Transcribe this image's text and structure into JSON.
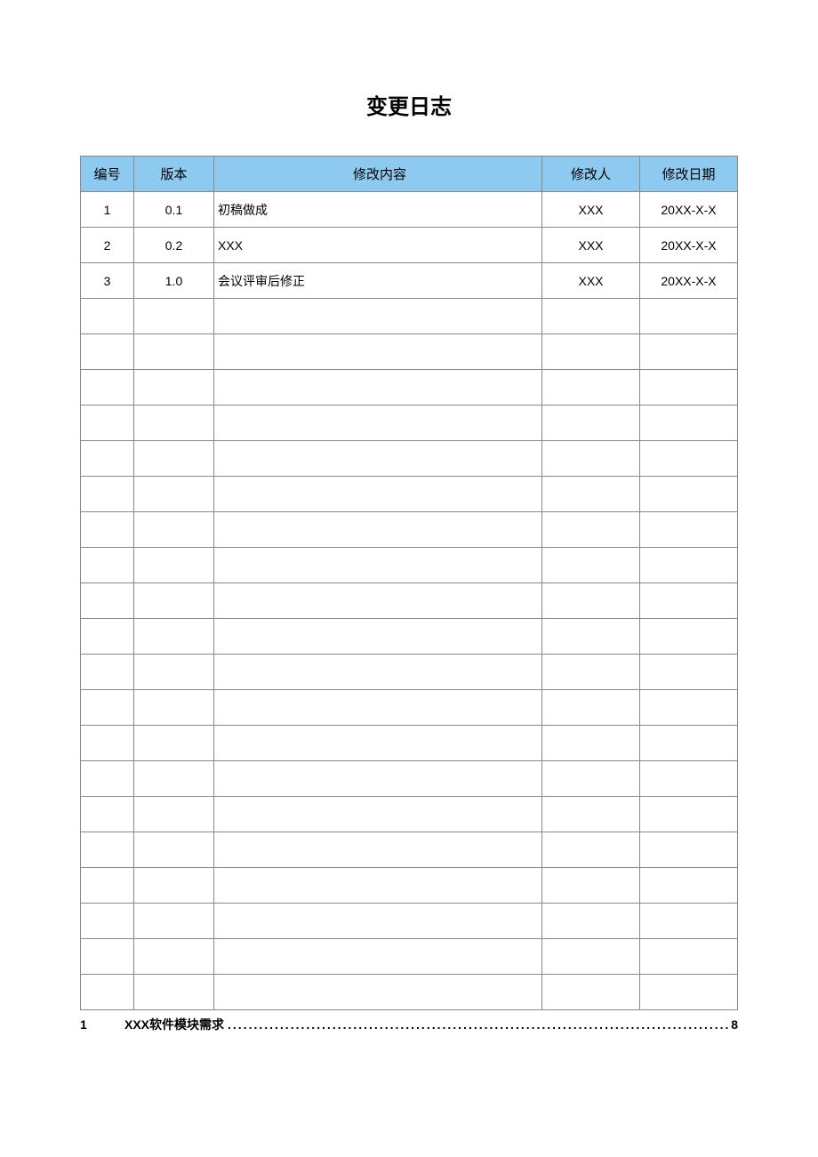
{
  "title": "变更日志",
  "headers": {
    "id": "编号",
    "version": "版本",
    "content": "修改内容",
    "modifier": "修改人",
    "date": "修改日期"
  },
  "rows": [
    {
      "id": "1",
      "version": "0.1",
      "content": "初稿做成",
      "modifier": "XXX",
      "date": "20XX-X-X"
    },
    {
      "id": "2",
      "version": "0.2",
      "content": "XXX",
      "modifier": "XXX",
      "date": "20XX-X-X"
    },
    {
      "id": "3",
      "version": "1.0",
      "content": "会议评审后修正",
      "modifier": "XXX",
      "date": "20XX-X-X"
    },
    {
      "id": "",
      "version": "",
      "content": "",
      "modifier": "",
      "date": ""
    },
    {
      "id": "",
      "version": "",
      "content": "",
      "modifier": "",
      "date": ""
    },
    {
      "id": "",
      "version": "",
      "content": "",
      "modifier": "",
      "date": ""
    },
    {
      "id": "",
      "version": "",
      "content": "",
      "modifier": "",
      "date": ""
    },
    {
      "id": "",
      "version": "",
      "content": "",
      "modifier": "",
      "date": ""
    },
    {
      "id": "",
      "version": "",
      "content": "",
      "modifier": "",
      "date": ""
    },
    {
      "id": "",
      "version": "",
      "content": "",
      "modifier": "",
      "date": ""
    },
    {
      "id": "",
      "version": "",
      "content": "",
      "modifier": "",
      "date": ""
    },
    {
      "id": "",
      "version": "",
      "content": "",
      "modifier": "",
      "date": ""
    },
    {
      "id": "",
      "version": "",
      "content": "",
      "modifier": "",
      "date": ""
    },
    {
      "id": "",
      "version": "",
      "content": "",
      "modifier": "",
      "date": ""
    },
    {
      "id": "",
      "version": "",
      "content": "",
      "modifier": "",
      "date": ""
    },
    {
      "id": "",
      "version": "",
      "content": "",
      "modifier": "",
      "date": ""
    },
    {
      "id": "",
      "version": "",
      "content": "",
      "modifier": "",
      "date": ""
    },
    {
      "id": "",
      "version": "",
      "content": "",
      "modifier": "",
      "date": ""
    },
    {
      "id": "",
      "version": "",
      "content": "",
      "modifier": "",
      "date": ""
    },
    {
      "id": "",
      "version": "",
      "content": "",
      "modifier": "",
      "date": ""
    },
    {
      "id": "",
      "version": "",
      "content": "",
      "modifier": "",
      "date": ""
    },
    {
      "id": "",
      "version": "",
      "content": "",
      "modifier": "",
      "date": ""
    },
    {
      "id": "",
      "version": "",
      "content": "",
      "modifier": "",
      "date": ""
    }
  ],
  "toc": {
    "num": "1",
    "text": "XXX软件模块需求",
    "page": "8"
  }
}
